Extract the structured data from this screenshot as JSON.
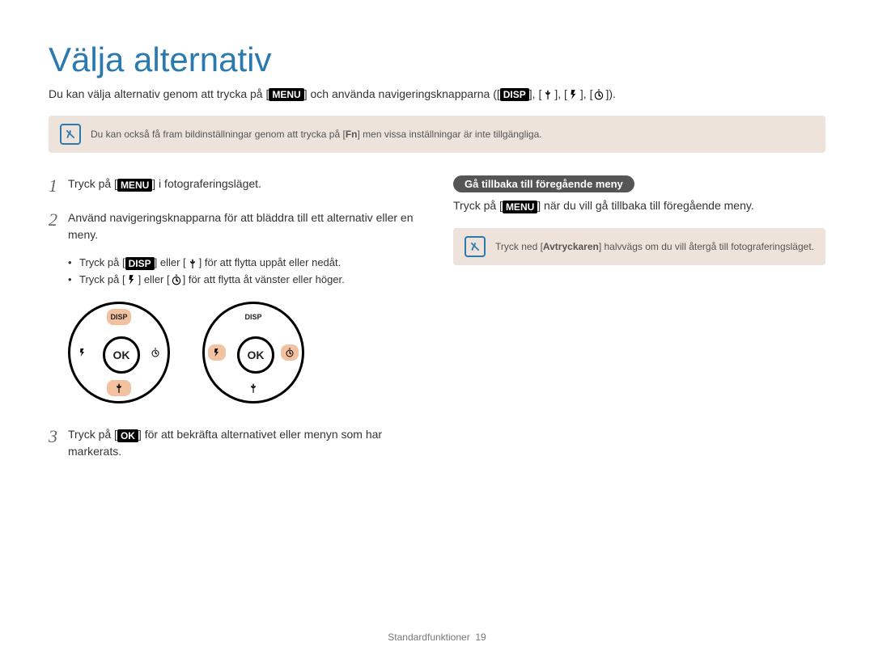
{
  "title": "Välja alternativ",
  "intro": {
    "part1": "Du kan välja alternativ genom att trycka på [",
    "menu_label": "MENU",
    "part2": "] och använda navigeringsknapparna ([",
    "disp_label": "DISP",
    "part3": "], [",
    "part4": "], [",
    "part5": "], [",
    "part6": "])."
  },
  "infobox1": {
    "part1": "Du kan också få fram bildinställningar genom att trycka på [",
    "fn_label": "Fn",
    "part2": "] men vissa inställningar är inte tillgängliga."
  },
  "steps": {
    "s1": {
      "num": "1",
      "part1": "Tryck på [",
      "menu": "MENU",
      "part2": "] i fotograferingsläget."
    },
    "s2": {
      "num": "2",
      "line": "Använd navigeringsknapparna för att bläddra till ett alternativ eller en meny.",
      "sub1": {
        "a": "Tryck på [",
        "disp": "DISP",
        "b": "] eller [",
        "c": "] för att flytta uppåt eller nedåt."
      },
      "sub2": {
        "a": "Tryck på [",
        "b": "] eller [",
        "c": "] för att flytta åt vänster eller höger."
      }
    },
    "s3": {
      "num": "3",
      "part1": "Tryck på [",
      "ok": "OK",
      "part2": "] för att bekräfta alternativet eller menyn som har markerats."
    }
  },
  "dial": {
    "ok": "OK",
    "disp": "DISP"
  },
  "right": {
    "pill": "Gå tillbaka till föregående meny",
    "text": {
      "a": "Tryck på [",
      "menu": "MENU",
      "b": "] när du vill gå tillbaka till föregående meny."
    },
    "info": {
      "a": "Tryck ned [",
      "shutter": "Avtryckaren",
      "b": "] halvvägs om du vill återgå till fotograferingsläget."
    }
  },
  "footer": {
    "section": "Standardfunktioner",
    "page": "19"
  }
}
